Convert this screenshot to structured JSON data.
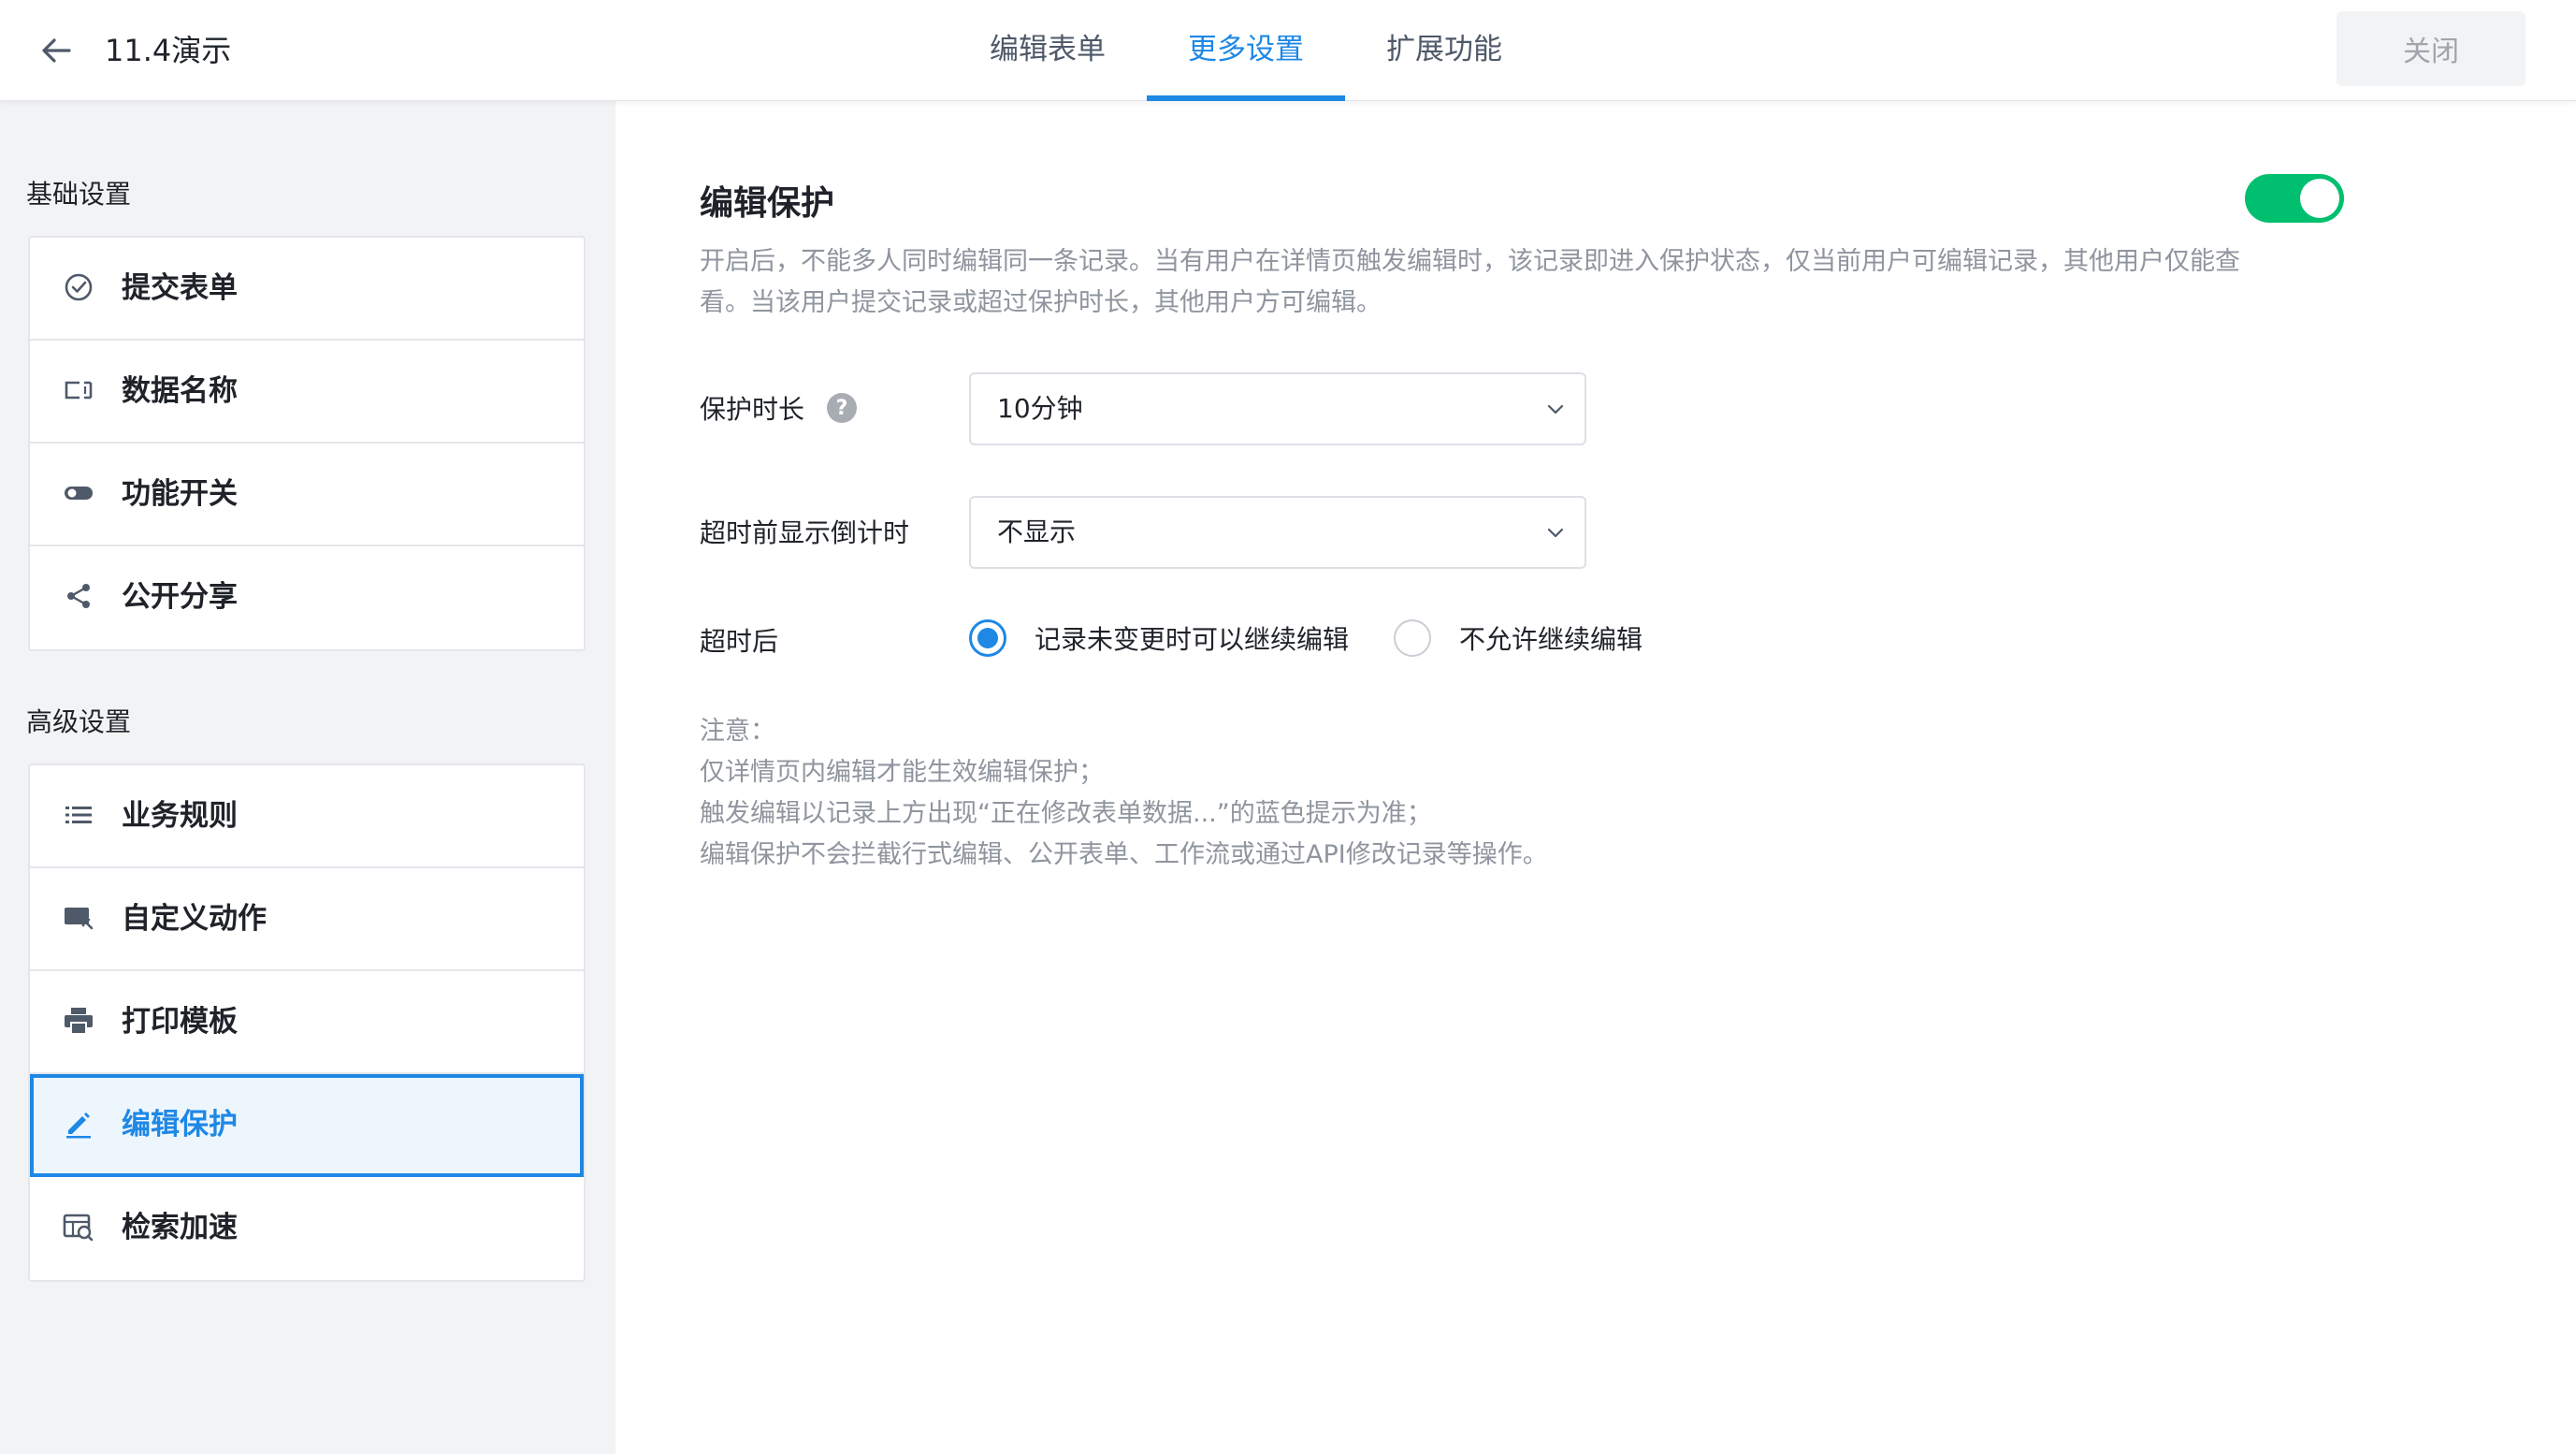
{
  "header": {
    "app_title": "11.4演示",
    "tabs": [
      {
        "label": "编辑表单"
      },
      {
        "label": "更多设置"
      },
      {
        "label": "扩展功能"
      }
    ],
    "active_tab": "更多设置",
    "close_label": "关闭"
  },
  "sidebar": {
    "basic_title": "基础设置",
    "basic_items": [
      {
        "label": "提交表单",
        "icon": "check-circle-icon"
      },
      {
        "label": "数据名称",
        "icon": "rename-icon"
      },
      {
        "label": "功能开关",
        "icon": "toggle-icon"
      },
      {
        "label": "公开分享",
        "icon": "share-icon"
      }
    ],
    "advanced_title": "高级设置",
    "advanced_items": [
      {
        "label": "业务规则",
        "icon": "list-icon"
      },
      {
        "label": "自定义动作",
        "icon": "custom-action-icon"
      },
      {
        "label": "打印模板",
        "icon": "printer-icon"
      },
      {
        "label": "编辑保护",
        "icon": "pencil-icon",
        "active": true
      },
      {
        "label": "检索加速",
        "icon": "search-accelerate-icon"
      }
    ]
  },
  "main": {
    "title": "编辑保护",
    "enabled": true,
    "description_line1": "开启后，不能多人同时编辑同一条记录。当有用户在详情页触发编辑时，该记录即进入保护状态，仅当前用户可编辑记录，其他用户仅能查",
    "description_line2": "看。当该用户提交记录或超过保护时长，其他用户方可编辑。",
    "duration_label": "保护时长",
    "duration_value": "10分钟",
    "countdown_label": "超时前显示倒计时",
    "countdown_value": "不显示",
    "timeout_label": "超时后",
    "timeout_options": [
      {
        "label": "记录未变更时可以继续编辑",
        "checked": true
      },
      {
        "label": "不允许继续编辑",
        "checked": false
      }
    ],
    "notes": [
      "注意：",
      "仅详情页内编辑才能生效编辑保护；",
      "触发编辑以记录上方出现“正在修改表单数据...”的蓝色提示为准；",
      "编辑保护不会拦截行式编辑、公开表单、工作流或通过API修改记录等操作。"
    ]
  },
  "colors": {
    "accent": "#1e88e5",
    "toggle_on": "#00bf6f",
    "sidebar_bg": "#f2f3f5"
  }
}
